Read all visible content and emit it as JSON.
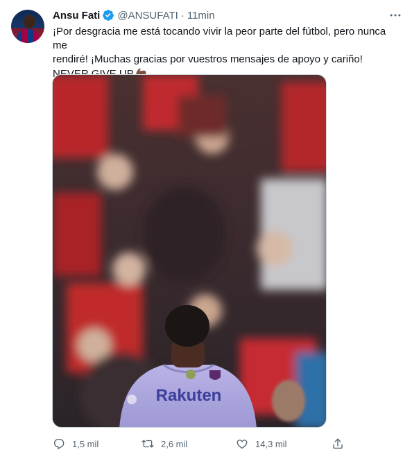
{
  "tweet": {
    "author_name": "Ansu Fati",
    "handle": "@ANSUFATI",
    "separator": "·",
    "time": "11min",
    "text_line1": "¡Por desgracia me está tocando vivir la peor parte del fútbol, pero nunca me",
    "text_line2": "rendiré! ¡Muchas gracias por vuestros mensajes de apoyo y cariño!",
    "text_line3": "NEVER GIVE UP",
    "emoji": "flexed-biceps-medium-dark-skin",
    "photo_jersey_text": "Rakuten",
    "replies": "1,5 mil",
    "retweets": "2,6 mil",
    "likes": "14,3 mil"
  },
  "icons": {
    "verified": "verified-badge-icon",
    "more": "more-horizontal-icon",
    "reply": "reply-icon",
    "retweet": "retweet-icon",
    "like": "heart-icon",
    "share": "share-icon"
  },
  "colors": {
    "text": "#0f1419",
    "secondary": "#536471",
    "verified": "#1d9bf0"
  }
}
